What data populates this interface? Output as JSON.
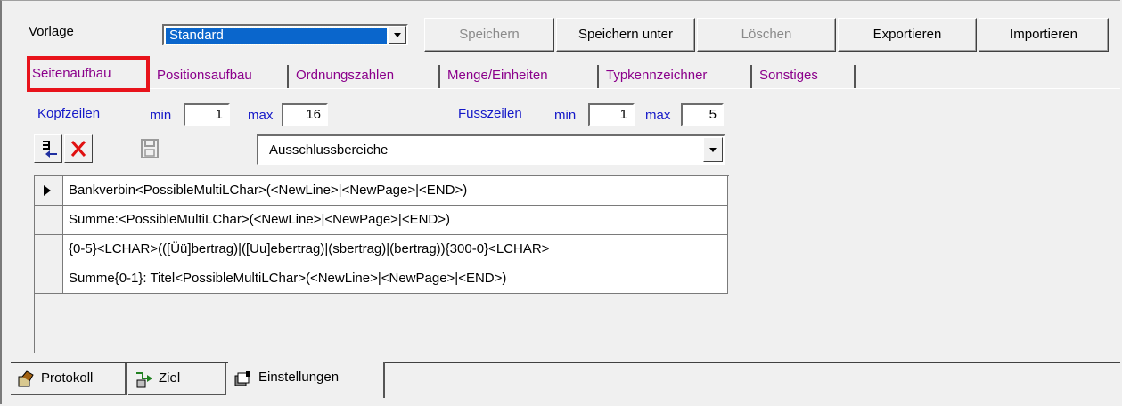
{
  "toolbar": {
    "vorlage_label": "Vorlage",
    "template_value": "Standard",
    "save_label": "Speichern",
    "save_as_label": "Speichern unter",
    "delete_label": "Löschen",
    "export_label": "Exportieren",
    "import_label": "Importieren"
  },
  "tabs": [
    {
      "label": "Seitenaufbau",
      "active": true
    },
    {
      "label": "Positionsaufbau"
    },
    {
      "label": "Ordnungszahlen"
    },
    {
      "label": "Menge/Einheiten"
    },
    {
      "label": "Typkennzeichner"
    },
    {
      "label": "Sonstiges"
    }
  ],
  "header_footer": {
    "kopf_label": "Kopfzeilen",
    "kopf_min_label": "min",
    "kopf_min": "1",
    "kopf_max_label": "max",
    "kopf_max": "16",
    "fuss_label": "Fusszeilen",
    "fuss_min_label": "min",
    "fuss_min": "1",
    "fuss_max_label": "max",
    "fuss_max": "5"
  },
  "area_select": {
    "value": "Ausschlussbereiche"
  },
  "rows": [
    "Bankverbin<PossibleMultiLChar>(<NewLine>|<NewPage>|<END>)",
    "Summe:<PossibleMultiLChar>(<NewLine>|<NewPage>|<END>)",
    "{0-5}<LCHAR>(([Üü]bertrag)|([Uu]ebertrag)|(sbertrag)|(bertrag)){300-0}<LCHAR>",
    "Summe{0-1}: Titel<PossibleMultiLChar>(<NewLine>|<NewPage>|<END>)"
  ],
  "bottom_tabs": [
    {
      "label": "Protokoll"
    },
    {
      "label": "Ziel"
    },
    {
      "label": "Einstellungen",
      "active": true
    }
  ],
  "colors": {
    "accent_tab": "#8b008b",
    "label_blue": "#1418c8",
    "highlight": "#e8131b",
    "selection": "#0a66cc"
  }
}
